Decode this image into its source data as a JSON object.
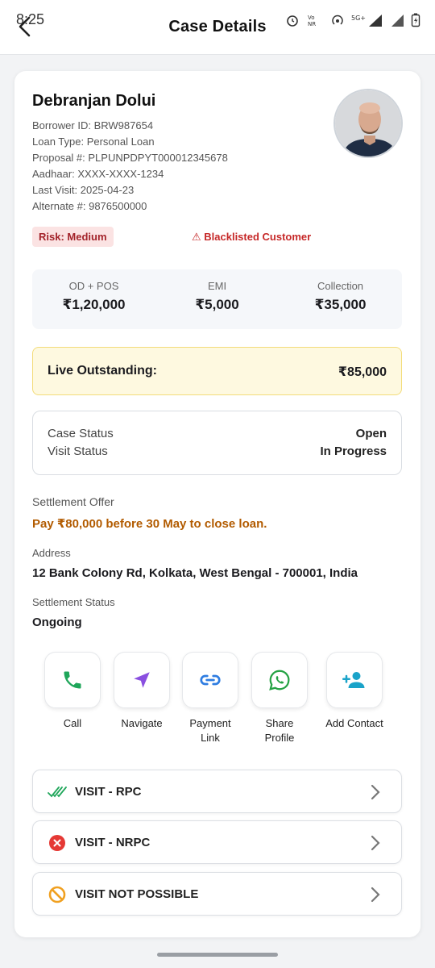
{
  "status_bar": {
    "time": "8:25"
  },
  "header": {
    "title": "Case Details"
  },
  "borrower": {
    "name": "Debranjan Dolui",
    "borrower_id": "Borrower ID: BRW987654",
    "loan_type": "Loan Type: Personal Loan",
    "proposal": "Proposal #: PLPUNPDPYT000012345678",
    "aadhaar": "Aadhaar: XXXX-XXXX-1234",
    "last_visit": "Last Visit: 2025-04-23",
    "alternate": "Alternate #: 9876500000"
  },
  "badges": {
    "risk": "Risk: Medium",
    "blacklisted": "⚠ Blacklisted Customer"
  },
  "stats": [
    {
      "label": "OD + POS",
      "value": "₹1,20,000"
    },
    {
      "label": "EMI",
      "value": "₹5,000"
    },
    {
      "label": "Collection",
      "value": "₹35,000"
    }
  ],
  "live_outstanding": {
    "label": "Live Outstanding:",
    "value": "₹85,000"
  },
  "case_status": {
    "case_label": "Case Status",
    "case_value": "Open",
    "visit_label": "Visit Status",
    "visit_value": "In Progress"
  },
  "settlement_offer": {
    "label": "Settlement Offer",
    "value": "Pay ₹80,000 before 30 May to close loan."
  },
  "address": {
    "label": "Address",
    "value": "12 Bank Colony Rd, Kolkata, West Bengal - 700001, India"
  },
  "settlement_status": {
    "label": "Settlement Status",
    "value": "Ongoing"
  },
  "actions": [
    {
      "label": "Call"
    },
    {
      "label": "Navigate"
    },
    {
      "label": "Payment Link"
    },
    {
      "label": "Share Profile"
    },
    {
      "label": "Add Contact"
    }
  ],
  "visits": [
    {
      "label": "VISIT - RPC"
    },
    {
      "label": "VISIT - NRPC"
    },
    {
      "label": "VISIT NOT POSSIBLE"
    }
  ],
  "colors": {
    "risk_bg": "#fbe3e3",
    "risk_text": "#a3232a",
    "blacklist": "#c62828",
    "offer": "#b25b00",
    "live_bg": "#fef9e0",
    "call_green": "#1fa65a",
    "navigate_purple": "#8a4fe0",
    "link_blue": "#2f7de1",
    "whatsapp_green": "#25a244",
    "contact_teal": "#1aa3c9"
  }
}
